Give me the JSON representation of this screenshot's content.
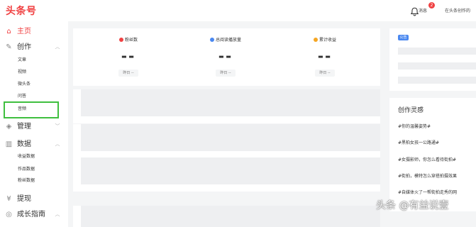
{
  "header": {
    "logo": "头条号",
    "bell_count": "2",
    "message_label": "消息",
    "creator_link": "在头条创作的"
  },
  "sidebar": {
    "home": "主页",
    "create": "创作",
    "create_items": [
      "文章",
      "视频",
      "微头条",
      "问答",
      "音频"
    ],
    "manage": "管理",
    "data": "数据",
    "data_items": [
      "收益数据",
      "作品数据",
      "粉丝数据"
    ],
    "withdraw": "提现",
    "growth": "成长指南"
  },
  "stats": [
    {
      "title": "粉丝数",
      "value": "--",
      "sub": "昨日 --",
      "color": "#f04142"
    },
    {
      "title": "总阅读播放量",
      "value": "--",
      "sub": "昨日 --",
      "color": "#4a88f0"
    },
    {
      "title": "累计收益",
      "value": "--",
      "sub": "昨日 --",
      "color": "#f5a623"
    }
  ],
  "notice": {
    "badge": "公告"
  },
  "inspiration": {
    "title": "创作灵感",
    "topics": [
      "#你的温馨姿势#",
      "#黑柏女孩一公路通#",
      "#女摄影师，你怎么看待街拍#",
      "#街拍，模特怎么穿搭拍摄效果",
      "#自媒体火了一帮街拍走秀的网"
    ]
  },
  "watermark": "头条 @有益说壹",
  "colors": {
    "brand": "#f04142",
    "highlight": "#3fbf3f",
    "notice": "#4a88f0"
  }
}
